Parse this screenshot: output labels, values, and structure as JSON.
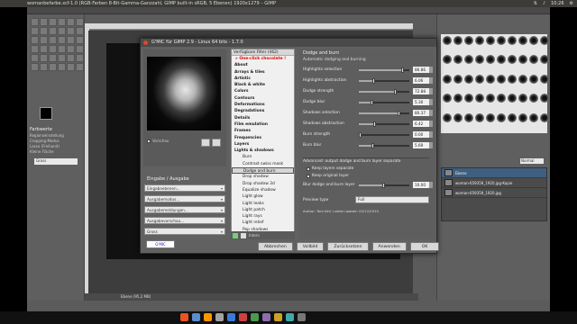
{
  "window": {
    "title": "womanbefarbe.xcf-1.0 (RGB-Farben 8-Bit-Gamma-Ganzzahl, GIMP built-in sRGB, 5 Ebenen) 1920x1279 – GIMP",
    "time": "10:26"
  },
  "toolbox": {
    "options_title": "Farbwerte",
    "options_lines": [
      "Regionseinstellung",
      "Cropping-Modus",
      "Lasso (Freihand)",
      "Kleine Fläche"
    ],
    "mode_value": "Gross"
  },
  "statusbar": {
    "text": "Ebene (95,2 MB)"
  },
  "right_panel": {
    "mode_label": "Normal",
    "layers": [
      {
        "name": "Ebene"
      },
      {
        "name": "woman-659359_1920.jpg-Kopie"
      },
      {
        "name": "woman-659359_1920.jpg"
      }
    ]
  },
  "dialog": {
    "title": "G'MIC für GIMP 2.9 - Linux 64 bits - 1.7.0",
    "preview": {
      "checkbox_label": "Vorschau"
    },
    "io": {
      "title": "Eingabe / Ausgabe",
      "combos": [
        "Eingabeebenen...",
        "Ausgabemodus...",
        "Ausgabemeldungen...",
        "Ausgabevorschau...",
        "Gross"
      ]
    },
    "filters": {
      "header": "Verfügbare Filter (462)",
      "items": [
        {
          "label": "» One-click chocolate !",
          "style": "red"
        },
        {
          "label": "About",
          "style": "bold"
        },
        {
          "label": "Arrays & tiles",
          "style": "bold"
        },
        {
          "label": "Artistic",
          "style": "bold"
        },
        {
          "label": "Black & white",
          "style": "bold"
        },
        {
          "label": "Colors",
          "style": "bold"
        },
        {
          "label": "Contours",
          "style": "bold"
        },
        {
          "label": "Deformations",
          "style": "bold"
        },
        {
          "label": "Degradations",
          "style": "bold"
        },
        {
          "label": "Details",
          "style": "bold"
        },
        {
          "label": "Film emulation",
          "style": "bold"
        },
        {
          "label": "Frames",
          "style": "bold"
        },
        {
          "label": "Frequencies",
          "style": "bold"
        },
        {
          "label": "Layers",
          "style": "bold"
        },
        {
          "label": "Lights & shadows",
          "style": "bold"
        },
        {
          "label": "Burn",
          "style": "sub"
        },
        {
          "label": "Contrast swiss mask",
          "style": "sub"
        },
        {
          "label": "Dodge and burn",
          "style": "sub sel"
        },
        {
          "label": "Drop shadow",
          "style": "sub"
        },
        {
          "label": "Drop shadow 3d",
          "style": "sub"
        },
        {
          "label": "Equalize shadow",
          "style": "sub"
        },
        {
          "label": "Light glow",
          "style": "sub"
        },
        {
          "label": "Light leaks",
          "style": "sub"
        },
        {
          "label": "Light patch",
          "style": "sub"
        },
        {
          "label": "Light rays",
          "style": "sub"
        },
        {
          "label": "Light relief",
          "style": "sub"
        },
        {
          "label": "Pop shadows",
          "style": "sub"
        }
      ],
      "bottom_label": "Intern"
    },
    "params": {
      "title": "Dodge and burn",
      "subtitle": "Automatic dodging and burning",
      "sliders": [
        {
          "label": "Highlights selection",
          "value": "86.86",
          "fraction": 0.87
        },
        {
          "label": "Highlights abstraction",
          "value": "6.06",
          "fraction": 0.3
        },
        {
          "label": "Dodge strength",
          "value": "72.88",
          "fraction": 0.73
        },
        {
          "label": "Dodge blur",
          "value": "5.30",
          "fraction": 0.27
        },
        {
          "label": "Shadows selection",
          "value": "80.37",
          "fraction": 0.8
        },
        {
          "label": "Shadows abstraction",
          "value": "6.42",
          "fraction": 0.32
        },
        {
          "label": "Burn strength",
          "value": "0.00",
          "fraction": 0.0
        },
        {
          "label": "Burn blur",
          "value": "5.69",
          "fraction": 0.28
        }
      ],
      "advanced_label": "Advanced: output dodge and burn layer separate",
      "checkboxes": [
        "Keep layers separate",
        "Keep original layer"
      ],
      "blur_slider": {
        "label": "Blur dodge and burn layer",
        "value": "10.00",
        "fraction": 0.5
      },
      "preview_type_label": "Preview type",
      "preview_type_value": "Full",
      "author": "Author: Tom Keil.   Latest update: 02/12/2015."
    },
    "buttons": [
      "Abbrechen",
      "Vollbild",
      "Zurücksetzen",
      "Anwenden",
      "OK"
    ]
  }
}
